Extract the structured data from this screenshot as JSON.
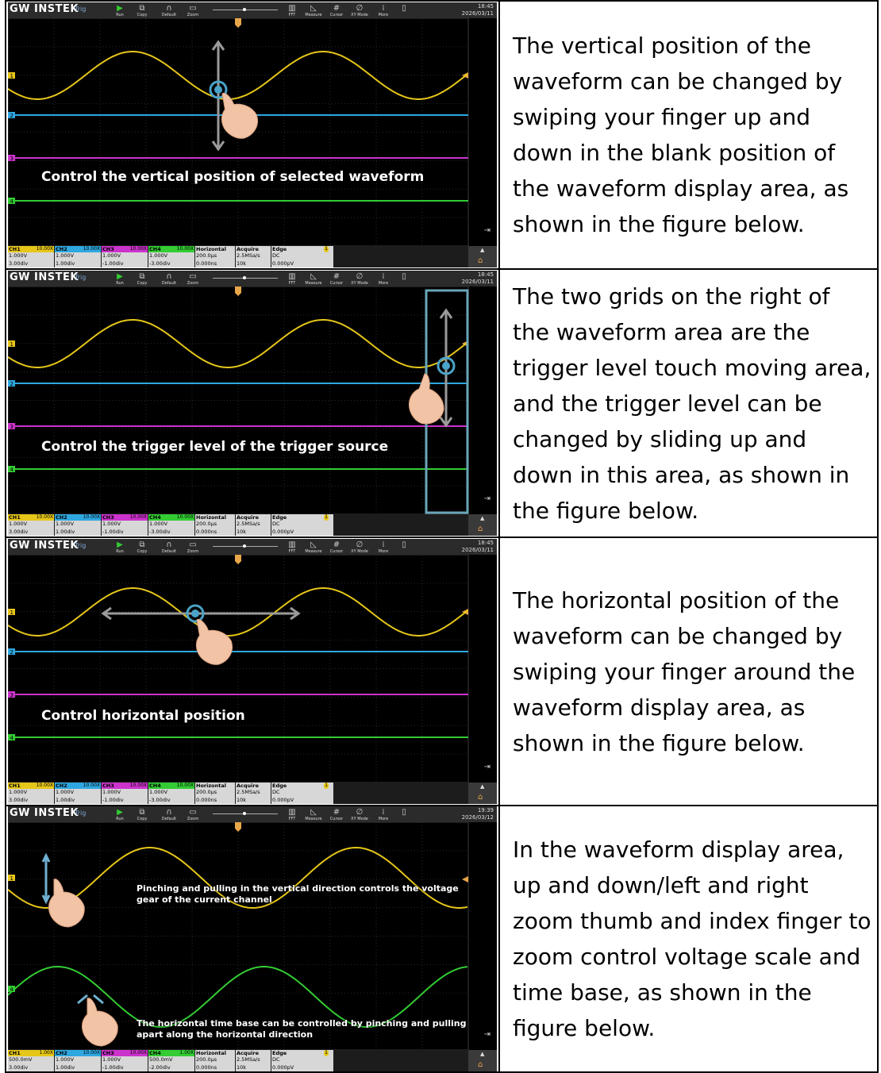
{
  "rows": [
    {
      "caption": "Control the vertical position of selected waveform",
      "description": "The vertical position of the waveform can be changed by swiping your finger up and down in the blank position of the waveform display area, as shown in the figure below.",
      "clock": {
        "time": "18:45",
        "date": "2026/03/11"
      },
      "status": {
        "ch1": {
          "label": "CH1",
          "probe": "10.00X",
          "scale": "1.000V",
          "pos": "3.00div"
        },
        "ch2": {
          "label": "CH2",
          "probe": "10.00X",
          "scale": "1.000V",
          "pos": "1.00div"
        },
        "ch3": {
          "label": "CH3",
          "probe": "10.00X",
          "scale": "1.000V",
          "pos": "-1.00div"
        },
        "ch4": {
          "label": "CH4",
          "probe": "10.00X",
          "scale": "1.000V",
          "pos": "-3.00div"
        }
      }
    },
    {
      "caption": "Control the trigger level of the trigger source",
      "description": "The two grids on the right of the waveform area are the trigger level touch moving area, and the trigger level can be changed by sliding up and down in this area, as shown in the figure below.",
      "clock": {
        "time": "18:45",
        "date": "2026/03/11"
      },
      "status": {
        "ch1": {
          "label": "CH1",
          "probe": "10.00X",
          "scale": "1.000V",
          "pos": "3.00div"
        },
        "ch2": {
          "label": "CH2",
          "probe": "10.00X",
          "scale": "1.000V",
          "pos": "1.00div"
        },
        "ch3": {
          "label": "CH3",
          "probe": "10.00X",
          "scale": "1.000V",
          "pos": "-1.00div"
        },
        "ch4": {
          "label": "CH4",
          "probe": "10.00X",
          "scale": "1.000V",
          "pos": "-3.00div"
        }
      }
    },
    {
      "caption": "Control horizontal position",
      "description": "The horizontal position of the waveform can be changed by swiping your finger around the waveform display area, as shown in the figure below.",
      "clock": {
        "time": "18:45",
        "date": "2026/03/11"
      },
      "status": {
        "ch1": {
          "label": "CH1",
          "probe": "10.00X",
          "scale": "1.000V",
          "pos": "3.00div"
        },
        "ch2": {
          "label": "CH2",
          "probe": "10.00X",
          "scale": "1.000V",
          "pos": "1.00div"
        },
        "ch3": {
          "label": "CH3",
          "probe": "10.00X",
          "scale": "1.000V",
          "pos": "-1.00div"
        },
        "ch4": {
          "label": "CH4",
          "probe": "10.00X",
          "scale": "1.000V",
          "pos": "-3.00div"
        }
      }
    },
    {
      "caption_vertical": "Pinching and pulling in the vertical direction controls the voltage gear of the current channel",
      "caption_horizontal": "The horizontal time base can be controlled by pinching and pulling apart along the horizontal direction",
      "description": "In the waveform display area, up and down/left and right zoom thumb and index finger to zoom control voltage scale and time base, as shown in the figure below.",
      "clock": {
        "time": "19:39",
        "date": "2026/03/12"
      },
      "status": {
        "ch1": {
          "label": "CH1",
          "probe": "1.00X",
          "scale": "500.0mV",
          "pos": "3.00div"
        },
        "ch2": {
          "label": "CH2",
          "probe": "10.00X",
          "scale": "1.000V",
          "pos": "1.00div"
        },
        "ch3": {
          "label": "CH3",
          "probe": "10.00X",
          "scale": "1.000V",
          "pos": "-1.00div"
        },
        "ch4": {
          "label": "CH4",
          "probe": "1.00X",
          "scale": "500.0mV",
          "pos": "-2.00div"
        }
      }
    }
  ],
  "toolbar": {
    "logo": "GW INSTEK",
    "trig": "Trig",
    "run": "Run",
    "copy": "Copy",
    "default": "Default",
    "zoom": "Zoom",
    "fft": "FFT",
    "measure": "Measure",
    "cursor": "Cursor",
    "xymode": "XY Mode",
    "more": "More"
  },
  "statusbar_common": {
    "horizontal": "Horizontal",
    "timebase": "200.0μs",
    "hpos": "0.000ns",
    "acquire": "Acquire",
    "rate": "2.5MSa/s",
    "depth": "10k",
    "edge": "Edge",
    "coupling": "DC",
    "level": "0.000pV",
    "trig_src": "1"
  },
  "colors": {
    "ch1": "#e6c619",
    "ch2": "#2fa7e0",
    "ch3": "#cc33cc",
    "ch4": "#33cc33",
    "accent": "#e8a64a"
  }
}
